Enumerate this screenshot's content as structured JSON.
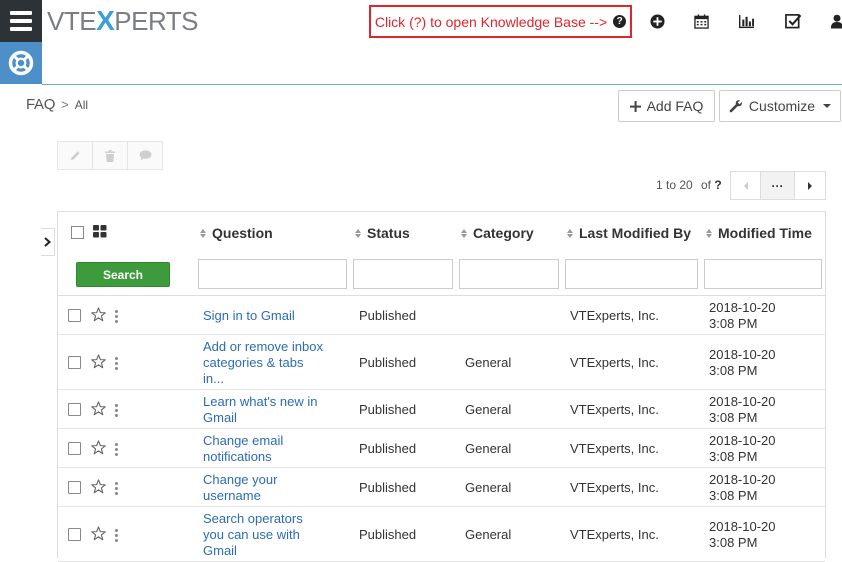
{
  "app": {
    "logo_parts": [
      "VTE",
      "X",
      "PERTS"
    ],
    "kb_hint": "Click (?) to open Knowledge Base -->"
  },
  "icons": {
    "menu": "hamburger-icon",
    "lifebuoy": "lifebuoy-icon",
    "help": "question-circle-icon",
    "add": "plus-circle-icon",
    "calendar": "calendar-icon",
    "reports": "bar-chart-icon",
    "tasks": "checkbox-icon",
    "user": "user-icon"
  },
  "breadcrumb": {
    "module": "FAQ",
    "separator": ">",
    "view": "All"
  },
  "toolbar": {
    "add_label": "Add FAQ",
    "customize_label": "Customize"
  },
  "pagination": {
    "range": "1 to 20",
    "of_label": "of",
    "total": "?",
    "more": "···"
  },
  "table": {
    "headers": [
      "Question",
      "Status",
      "Category",
      "Last Modified By",
      "Modified Time"
    ],
    "search_label": "Search",
    "rows": [
      {
        "question": "Sign in to Gmail",
        "status": "Published",
        "category": "",
        "modified_by": "VTExperts, Inc.",
        "modified_date": "2018-10-20",
        "modified_time": "3:08 PM"
      },
      {
        "question": "Add or remove inbox categories & tabs in...",
        "status": "Published",
        "category": "General",
        "modified_by": "VTExperts, Inc.",
        "modified_date": "2018-10-20",
        "modified_time": "3:08 PM"
      },
      {
        "question": "Learn what's new in Gmail",
        "status": "Published",
        "category": "General",
        "modified_by": "VTExperts, Inc.",
        "modified_date": "2018-10-20",
        "modified_time": "3:08 PM"
      },
      {
        "question": "Change email notifications",
        "status": "Published",
        "category": "General",
        "modified_by": "VTExperts, Inc.",
        "modified_date": "2018-10-20",
        "modified_time": "3:08 PM"
      },
      {
        "question": "Change your username",
        "status": "Published",
        "category": "General",
        "modified_by": "VTExperts, Inc.",
        "modified_date": "2018-10-20",
        "modified_time": "3:08 PM"
      },
      {
        "question": "Search operators you can use with Gmail",
        "status": "Published",
        "category": "General",
        "modified_by": "VTExperts, Inc.",
        "modified_date": "2018-10-20",
        "modified_time": "3:08 PM"
      }
    ]
  },
  "colors": {
    "accent": "#4d90c9",
    "dark": "#2d3237",
    "link": "#2c6cb5",
    "search_button": "#3d9b3c",
    "hint_border": "#e0252b"
  }
}
